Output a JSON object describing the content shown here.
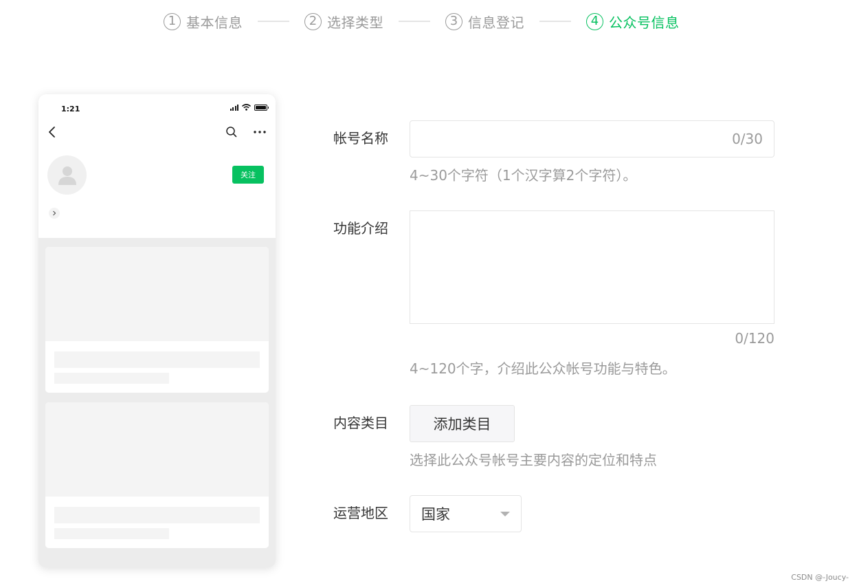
{
  "stepper": {
    "steps": [
      {
        "num": "1",
        "label": "基本信息",
        "state": "done"
      },
      {
        "num": "2",
        "label": "选择类型",
        "state": "done"
      },
      {
        "num": "3",
        "label": "信息登记",
        "state": "done"
      },
      {
        "num": "4",
        "label": "公众号信息",
        "state": "active"
      }
    ],
    "active_color": "#07c160",
    "inactive_color": "#9a9a9a"
  },
  "phone_preview": {
    "status_time": "1:21",
    "icons": [
      "back-arrow-icon",
      "search-icon",
      "more-icon",
      "signal-icon",
      "wifi-icon",
      "battery-icon",
      "avatar-placeholder-icon",
      "chevron-right-icon"
    ],
    "follow_label": "关注",
    "follow_color": "#07c160"
  },
  "form": {
    "account_name": {
      "label": "帐号名称",
      "value": "",
      "counter": "0/30",
      "hint": "4~30个字符（1个汉字算2个字符）。"
    },
    "intro": {
      "label": "功能介绍",
      "value": "",
      "counter": "0/120",
      "hint": "4~120个字，介绍此公众帐号功能与特色。"
    },
    "category": {
      "label": "内容类目",
      "button_label": "添加类目",
      "hint": "选择此公众号帐号主要内容的定位和特点"
    },
    "region": {
      "label": "运营地区",
      "selected": "国家"
    }
  },
  "watermark": "CSDN @-Joucy-"
}
